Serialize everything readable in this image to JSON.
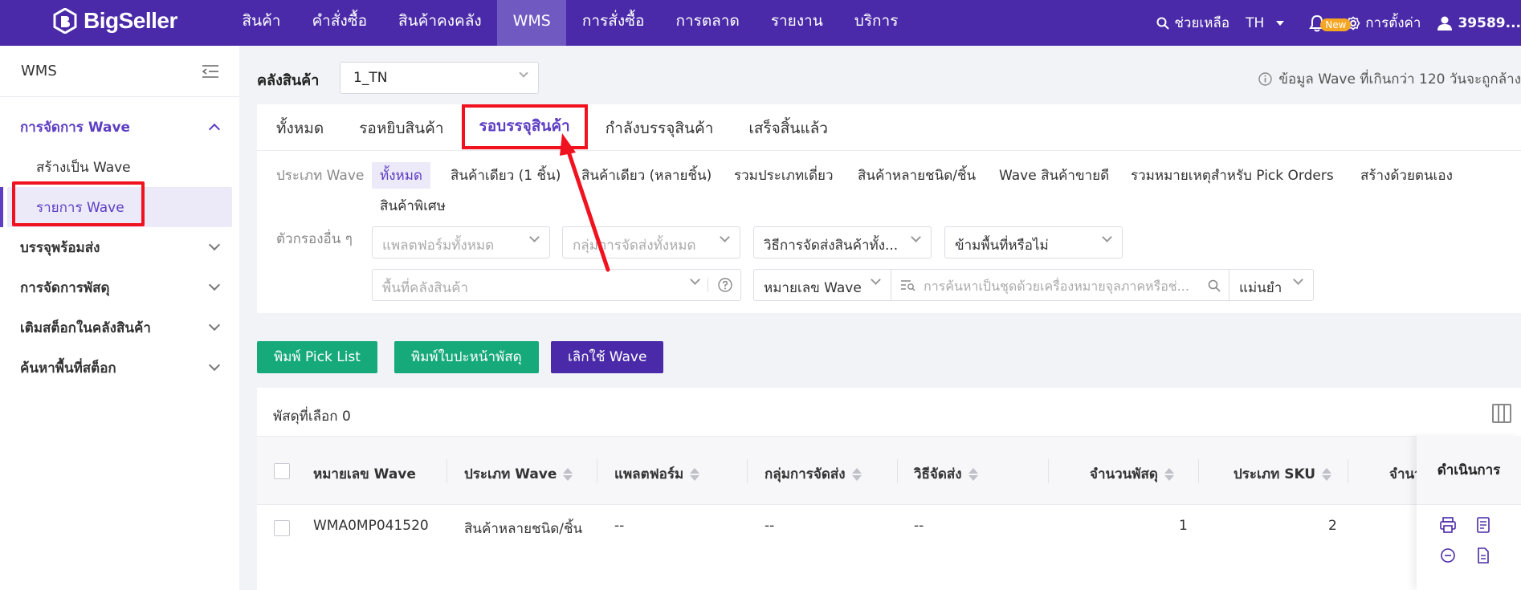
{
  "app": {
    "logo_text": "BigSeller"
  },
  "nav": {
    "items": [
      "สินค้า",
      "คำสั่งซื้อ",
      "สินค้าคงคลัง",
      "WMS",
      "การสั่งซื้อ",
      "การตลาด",
      "รายงาน",
      "บริการ"
    ],
    "active_index": 3
  },
  "topright": {
    "help": "ช่วยเหลือ",
    "lang": "TH",
    "new_badge": "New",
    "settings": "การตั้งค่า",
    "user": "39589..."
  },
  "sidebar": {
    "title": "WMS",
    "groups": [
      {
        "label": "การจัดการ Wave",
        "expanded": true,
        "items": [
          "สร้างเป็น Wave",
          "รายการ Wave"
        ],
        "active_item": 1
      },
      {
        "label": "บรรจุพร้อมส่ง"
      },
      {
        "label": "การจัดการพัสดุ"
      },
      {
        "label": "เติมสต็อกในคลังสินค้า"
      },
      {
        "label": "ค้นหาพื้นที่สต็อก"
      }
    ]
  },
  "warehouse": {
    "label": "คลังสินค้า",
    "value": "1_TN",
    "note": "ข้อมูล Wave ที่เกินกว่า 120 วันจะถูกล้าง"
  },
  "tabs": {
    "items": [
      "ทั้งหมด",
      "รอหยิบสินค้า",
      "รอบรรจุสินค้า",
      "กำลังบรรจุสินค้า",
      "เสร็จสิ้นแล้ว"
    ],
    "active_index": 2
  },
  "filters": {
    "wave_type_label": "ประเภท Wave",
    "wave_types": [
      "ทั้งหมด",
      "สินค้าเดียว (1 ชิ้น)",
      "สินค้าเดียว (หลายชิ้น)",
      "รวมประเภทเดี่ยว",
      "สินค้าหลายชนิด/ชิ้น",
      "Wave สินค้าขายดี",
      "รวมหมายเหตุสำหรับ Pick Orders",
      "สร้างด้วยตนเอง",
      "สินค้าพิเศษ"
    ],
    "other_label": "ตัวกรองอื่น ๆ",
    "platform_placeholder": "แพลตฟอร์มทั้งหมด",
    "shipping_group_placeholder": "กลุ่มการจัดส่งทั้งหมด",
    "shipping_method_placeholder": "วิธีการจัดส่งสินค้าทั้ง...",
    "cross_zone_placeholder": "ข้ามพื้นที่หรือไม่",
    "zone_placeholder": "พื้นที่คลังสินค้า",
    "search_field": "หมายเลข Wave",
    "search_placeholder": "การค้นหาเป็นชุดด้วยเครื่องหมายจุลภาคหรือช่...",
    "match_mode": "แม่นยำ"
  },
  "buttons": {
    "print_pick": "พิมพ์ Pick List",
    "print_label": "พิมพ์ใบปะหน้าพัสดุ",
    "cancel_wave": "เลิกใช้ Wave"
  },
  "table": {
    "selected_text": "พัสดุที่เลือก 0",
    "columns": [
      "หมายเลข Wave",
      "ประเภท Wave",
      "แพลตฟอร์ม",
      "กลุ่มการจัดส่ง",
      "วิธีจัดส่ง",
      "จำนวนพัสดุ",
      "ประเภท SKU",
      "จำนว"
    ],
    "actions_header": "ดำเนินการ",
    "rows": [
      {
        "wave_no": "WMA0MP041520",
        "wave_type": "สินค้าหลายชนิด/ชิ้น",
        "platform": "--",
        "shipping_group": "--",
        "shipping_method": "--",
        "parcels": "1",
        "sku_types": "2"
      }
    ]
  },
  "colors": {
    "brand": "#4a2aa8",
    "accent": "#5d3ec2",
    "green": "#16a97a",
    "annotation": "#f0121f"
  },
  "icons": [
    "logo-icon",
    "search-icon",
    "caret-down-icon",
    "bell-icon",
    "gear-icon",
    "user-icon",
    "collapse-menu-icon",
    "chevron-up-icon",
    "chevron-down-icon",
    "info-icon",
    "help-circle-icon",
    "filter-list-icon",
    "columns-icon",
    "print-icon",
    "clipboard-icon",
    "minus-circle-icon",
    "document-icon"
  ]
}
